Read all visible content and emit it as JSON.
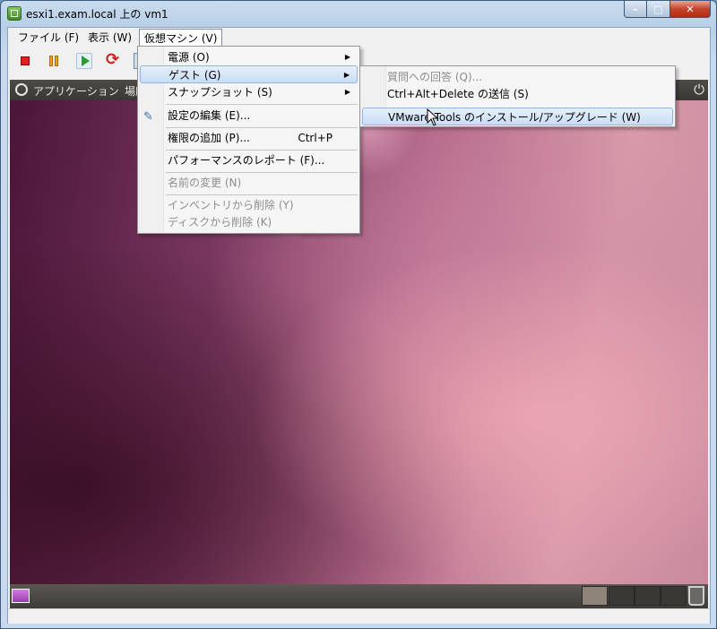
{
  "window": {
    "title": "esxi1.exam.local 上の vm1"
  },
  "menubar": [
    "ファイル (F)",
    "表示 (W)",
    "仮想マシン (V)"
  ],
  "vm_panel": {
    "applications": "アプリケーション",
    "places": "場所"
  },
  "vm_menu": {
    "items": [
      {
        "label": "電源 (O)",
        "submenu": true
      },
      {
        "label": "ゲスト (G)",
        "submenu": true,
        "highlighted": true
      },
      {
        "label": "スナップショット (S)",
        "submenu": true
      },
      {
        "label": "設定の編集 (E)...",
        "icon": "settings-icon"
      },
      {
        "label": "権限の追加 (P)...",
        "accel": "Ctrl+P"
      },
      {
        "label": "パフォーマンスのレポート (F)..."
      },
      {
        "label": "名前の変更 (N)",
        "disabled": true
      },
      {
        "label": "インベントリから削除 (Y)",
        "disabled": true
      },
      {
        "label": "ディスクから削除 (K)",
        "disabled": true
      }
    ]
  },
  "guest_menu": {
    "items": [
      {
        "label": "質問への回答 (Q)...",
        "disabled": true
      },
      {
        "label": "Ctrl+Alt+Delete の送信 (S)"
      },
      {
        "label": "VMware Tools のインストール/アップグレード (W)",
        "highlighted": true
      }
    ]
  },
  "colors": {
    "highlight": "#c8ddf5",
    "desktop_accent": "#7a3860"
  }
}
